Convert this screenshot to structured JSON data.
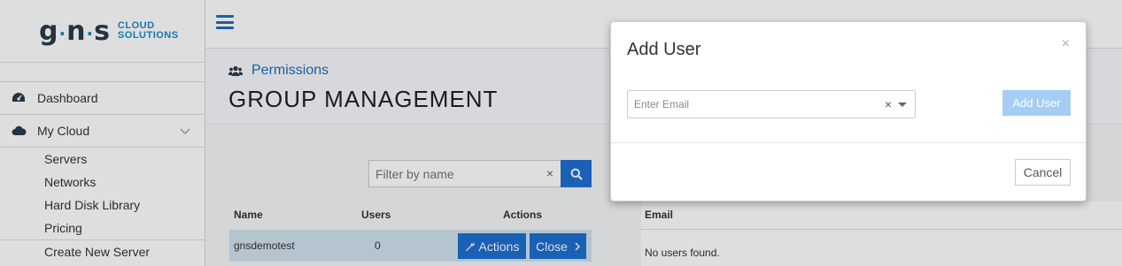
{
  "brand": {
    "logo_main": "gns",
    "logo_line1": "CLOUD",
    "logo_line2": "SOLUTIONS",
    "accent": "#1e88c7"
  },
  "sidebar": {
    "items": [
      {
        "label": "Dashboard",
        "icon": "dashboard-icon"
      },
      {
        "label": "My Cloud",
        "icon": "cloud-icon",
        "expanded": true
      }
    ],
    "sub_items": [
      "Servers",
      "Networks",
      "Hard Disk Library",
      "Pricing",
      "Create New Server"
    ]
  },
  "header": {
    "breadcrumb": "Permissions",
    "breadcrumb_icon": "users-icon",
    "title": "GROUP MANAGEMENT"
  },
  "groups": {
    "filter_placeholder": "Filter by name",
    "filter_clear": "×",
    "columns": [
      "Name",
      "Users",
      "Actions"
    ],
    "rows": [
      {
        "name": "gnsdemotest",
        "users": "0",
        "actions_label": "Actions",
        "close_label": "Close"
      }
    ]
  },
  "users": {
    "columns": [
      "Email"
    ],
    "empty_text": "No users found."
  },
  "modal": {
    "title": "Add User",
    "close_symbol": "×",
    "email_placeholder": "Enter Email",
    "email_clear": "×",
    "add_button": "Add User",
    "cancel_button": "Cancel"
  },
  "colors": {
    "primary": "#1e6fcf",
    "primary_disabled": "#a6cef4",
    "row_highlight": "#cfe3ef"
  }
}
